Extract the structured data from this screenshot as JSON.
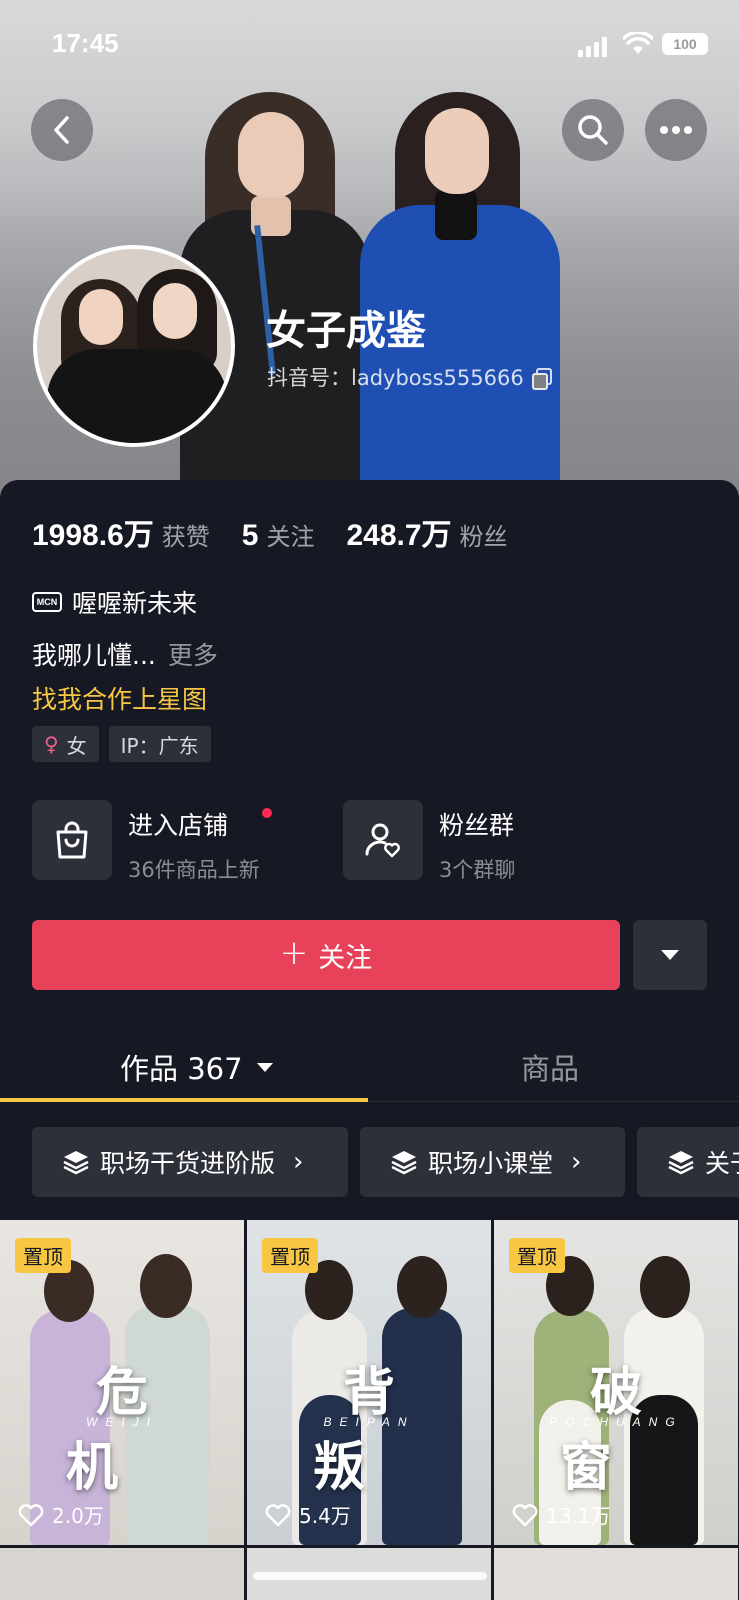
{
  "status_bar": {
    "time": "17:45",
    "battery": "100"
  },
  "profile": {
    "name": "女子成鉴",
    "douyin_id": "抖音号：ladyboss555666"
  },
  "stats": [
    {
      "value": "1998.6万",
      "label": "获赞"
    },
    {
      "value": "5",
      "label": "关注"
    },
    {
      "value": "248.7万",
      "label": "粉丝"
    }
  ],
  "mcn": {
    "badge": "MCN",
    "name": "喔喔新未来"
  },
  "bio": {
    "text": "我哪儿懂...",
    "more": "更多"
  },
  "cta_link": "找我合作上星图",
  "tags": [
    {
      "icon": "female-icon",
      "label": "女"
    },
    {
      "label": "IP：广东"
    }
  ],
  "features": [
    {
      "icon": "shopping-bag-icon",
      "title": "进入店铺",
      "subtitle": "36件商品上新"
    },
    {
      "icon": "fan-group-icon",
      "title": "粉丝群",
      "subtitle": "3个群聊"
    }
  ],
  "follow_button": {
    "label": "关注"
  },
  "tabs": [
    {
      "label": "作品 367",
      "active": true
    },
    {
      "label": "商品",
      "active": false
    }
  ],
  "collections": [
    {
      "label": "职场干货进阶版"
    },
    {
      "label": "职场小课堂"
    },
    {
      "label": "关于"
    }
  ],
  "videos": [
    {
      "pinned": "置顶",
      "title": "危机",
      "subtitle": "WEIJI",
      "likes": "2.0万"
    },
    {
      "pinned": "置顶",
      "title": "背叛",
      "subtitle": "BEIPAN",
      "likes": "5.4万"
    },
    {
      "pinned": "置顶",
      "title": "破窗",
      "subtitle": "POCHUANG",
      "likes": "13.1万"
    }
  ],
  "colors": {
    "accent_yellow": "#f7c743",
    "follow_red": "#e8415a",
    "background": "#161823"
  }
}
